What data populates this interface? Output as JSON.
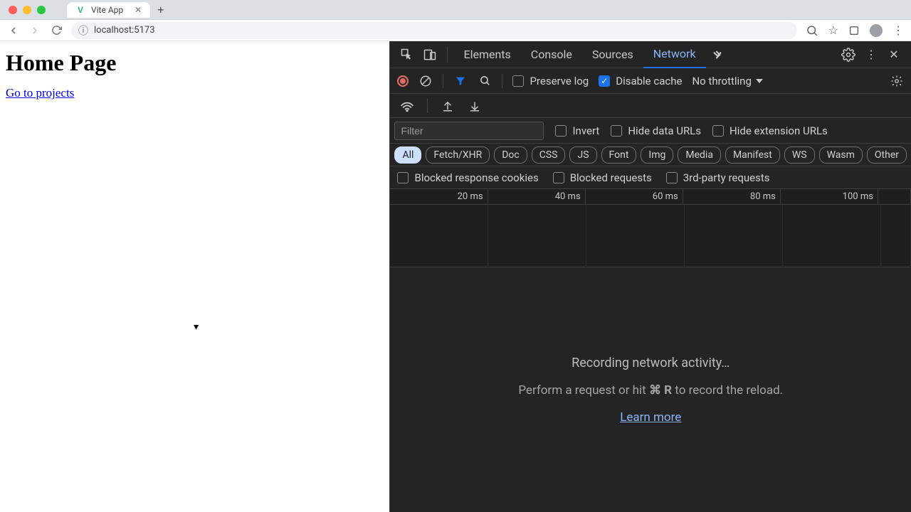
{
  "browser": {
    "tab_title": "Vite App",
    "url": "localhost:5173"
  },
  "page": {
    "heading": "Home Page",
    "link_text": "Go to projects"
  },
  "devtools": {
    "panels": [
      "Elements",
      "Console",
      "Sources",
      "Network"
    ],
    "active_panel": "Network",
    "toolbar": {
      "preserve_log": "Preserve log",
      "disable_cache": "Disable cache",
      "throttling": "No throttling"
    },
    "filter": {
      "placeholder": "Filter",
      "invert": "Invert",
      "hide_data_urls": "Hide data URLs",
      "hide_ext_urls": "Hide extension URLs"
    },
    "types": [
      "All",
      "Fetch/XHR",
      "Doc",
      "CSS",
      "JS",
      "Font",
      "Img",
      "Media",
      "Manifest",
      "WS",
      "Wasm",
      "Other"
    ],
    "blocked": {
      "cookies": "Blocked response cookies",
      "requests": "Blocked requests",
      "third_party": "3rd-party requests"
    },
    "timeline_ticks": [
      "20 ms",
      "40 ms",
      "60 ms",
      "80 ms",
      "100 ms"
    ],
    "empty": {
      "line1": "Recording network activity…",
      "line2_pre": "Perform a request or hit ",
      "line2_key": "⌘ R",
      "line2_post": " to record the reload.",
      "learn_more": "Learn more"
    }
  }
}
